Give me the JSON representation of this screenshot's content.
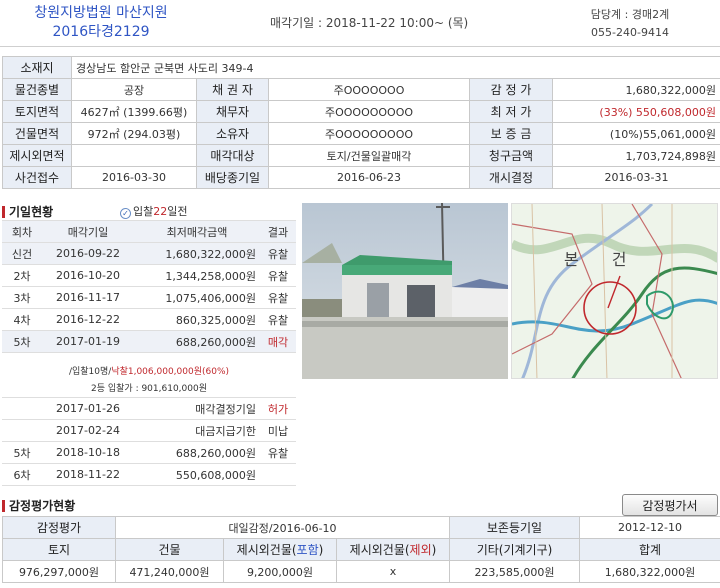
{
  "header": {
    "court": "창원지방법원 마산지원",
    "case_no": "2016타경2129",
    "sale_date": "매각기일 : 2018-11-22  10:00~ (목)",
    "dept": "담당계 : 경매2계",
    "phone": "055-240-9414"
  },
  "info": {
    "address_label": "소재지",
    "address": "경상남도 함안군 군북면 사도리 349-4",
    "rows": [
      {
        "l1": "물건종별",
        "v1": "공장",
        "l2": "채 권 자",
        "v2": "주OOOOOOO",
        "l3": "감 정 가",
        "v3": "1,680,322,000원"
      },
      {
        "l1": "토지면적",
        "v1": "4627㎡ (1399.66평)",
        "l2": "채무자",
        "v2": "주OOOOOOOOO",
        "l3": "최 저 가",
        "v3": "(33%) 550,608,000원"
      },
      {
        "l1": "건물면적",
        "v1": "972㎡ (294.03평)",
        "l2": "소유자",
        "v2": "주OOOOOOOOO",
        "l3": "보 증 금",
        "v3": "(10%)55,061,000원"
      },
      {
        "l1": "제시외면적",
        "v1": "",
        "l2": "매각대상",
        "v2": "토지/건물일괄매각",
        "l3": "청구금액",
        "v3": "1,703,724,898원"
      },
      {
        "l1": "사건접수",
        "v1": "2016-03-30",
        "l2": "배당종기일",
        "v2": "2016-06-23",
        "l3": "개시결정",
        "v3": "2016-03-31"
      }
    ]
  },
  "history": {
    "title": "기일현황",
    "bidders_prefix": "입찰",
    "bidders_days": "22",
    "bidders_suffix": "일전",
    "headers": [
      "회차",
      "매각기일",
      "최저매각금액",
      "결과"
    ],
    "rows": [
      {
        "round": "신건",
        "date": "2016-09-22",
        "amount": "1,680,322,000원",
        "result": "유찰"
      },
      {
        "round": "2차",
        "date": "2016-10-20",
        "amount": "1,344,258,000원",
        "result": "유찰"
      },
      {
        "round": "3차",
        "date": "2016-11-17",
        "amount": "1,075,406,000원",
        "result": "유찰"
      },
      {
        "round": "4차",
        "date": "2016-12-22",
        "amount": "860,325,000원",
        "result": "유찰"
      },
      {
        "round": "5차",
        "date": "2017-01-19",
        "amount": "688,260,000원",
        "result": "매각"
      }
    ],
    "sale_note_a": "/입찰10명/",
    "sale_note_b": "낙찰1,006,000,000원(60%)",
    "second_note": "2등 입찰가 : 901,610,000원",
    "rows2": [
      {
        "round": "",
        "date": "2017-01-26",
        "amount": "매각결정기일",
        "result": "허가"
      },
      {
        "round": "",
        "date": "2017-02-24",
        "amount": "대금지급기한",
        "result": "미납"
      },
      {
        "round": "5차",
        "date": "2018-10-18",
        "amount": "688,260,000원",
        "result": "유찰"
      },
      {
        "round": "6차",
        "date": "2018-11-22",
        "amount": "550,608,000원",
        "result": ""
      }
    ]
  },
  "map": {
    "label": "본 건"
  },
  "appraisal": {
    "title": "감정평가현황",
    "button": "감정평가서",
    "r1": {
      "l1": "감정평가",
      "v1": "대일감정/2016-06-10",
      "l2": "보존등기일",
      "v2": "2012-12-10"
    },
    "h_land": "토지",
    "h_building": "건물",
    "h_ext_in_a": "제시외건물(",
    "h_ext_in_b": "포함",
    "h_ext_ex_b": "제외",
    "h_close": ")",
    "h_etc": "기타(기계기구)",
    "h_total": "합계",
    "v_land": "976,297,000원",
    "v_building": "471,240,000원",
    "v_ext_in": "9,200,000원",
    "v_ext_ex": "x",
    "v_etc": "223,585,000원",
    "v_total": "1,680,322,000원"
  }
}
